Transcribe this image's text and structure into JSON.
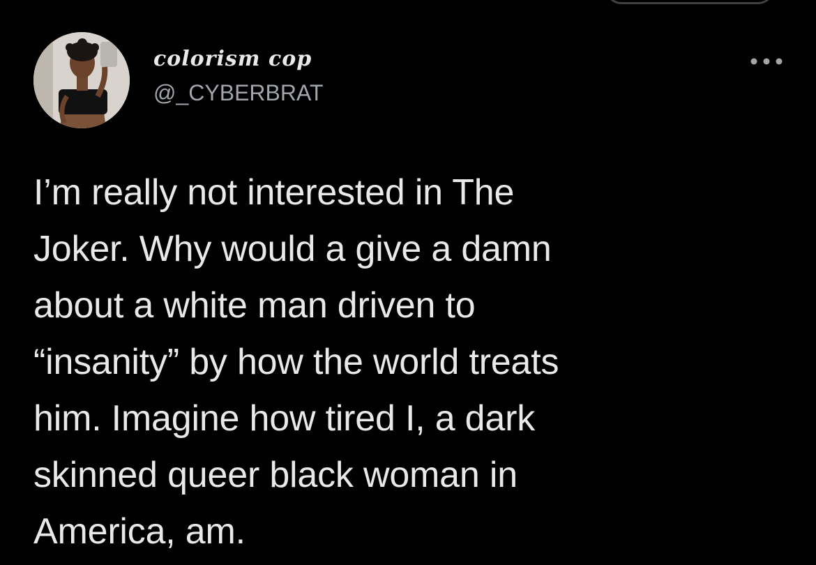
{
  "tweet": {
    "author": {
      "display_name": "colorism cop",
      "handle": "@_CYBERBRAT",
      "avatar_icon": "profile-photo"
    },
    "more_icon": "more-options-icon",
    "text": "I’m really not interested in The\nJoker. Why would a give a damn\nabout a white man driven to\n“insanity” by how the world treats\nhim. Imagine how tired I, a dark\nskinned queer black woman in\nAmerica, am."
  },
  "colors": {
    "background": "#000000",
    "text_primary": "#e7e9ea",
    "text_secondary": "#a2a6ab"
  }
}
